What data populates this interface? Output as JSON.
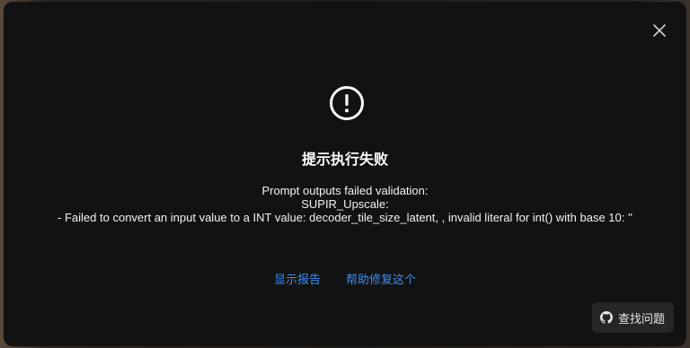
{
  "dialog": {
    "title": "提示执行失败",
    "message_lines": [
      "Prompt outputs failed validation:",
      "SUPIR_Upscale:",
      "- Failed to convert an input value to a INT value: decoder_tile_size_latent, , invalid literal for int() with base 10: ''"
    ],
    "links": {
      "show_report": "显示报告",
      "help_fix": "帮助修复这个"
    },
    "find_issue_label": "查找问题",
    "icons": {
      "alert": "exclamation-circle-icon",
      "close": "close-icon",
      "github": "github-icon"
    },
    "colors": {
      "background": "#121212",
      "link": "#3b8ff0",
      "button_bg": "#262626"
    }
  }
}
